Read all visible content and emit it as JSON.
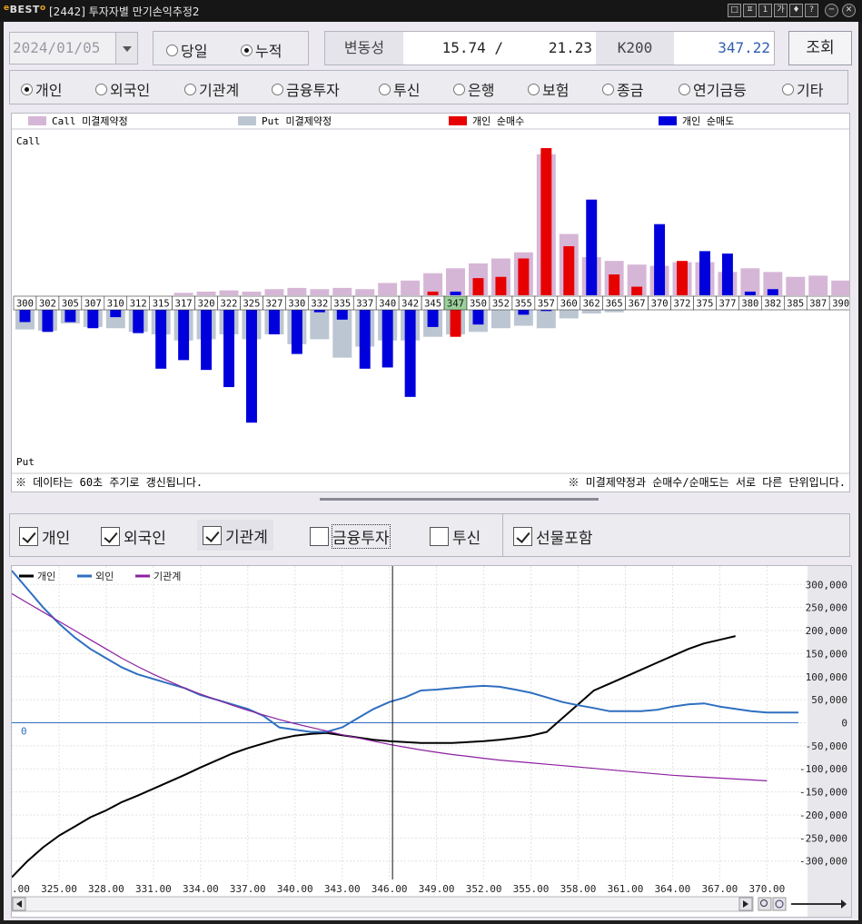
{
  "window": {
    "logo": "BEST",
    "title": "[2442] 투자자별 만기손익추정2",
    "buttons": [
      "□",
      "ㅍ",
      "1",
      "가",
      "♦",
      "?",
      "─",
      "✕"
    ]
  },
  "toolbar": {
    "date": "2024/01/05",
    "mode_options": [
      {
        "label": "당일",
        "selected": false
      },
      {
        "label": "누적",
        "selected": true
      }
    ],
    "volatility_label": "변동성",
    "volatility_call": "15.74 /",
    "volatility_put": "21.23",
    "k200_label": "K200",
    "k200_value": "347.22",
    "query_button": "조회"
  },
  "investors": [
    {
      "label": "개인",
      "selected": true
    },
    {
      "label": "외국인",
      "selected": false
    },
    {
      "label": "기관계",
      "selected": false
    },
    {
      "label": "금융투자",
      "selected": false
    },
    {
      "label": "투신",
      "selected": false
    },
    {
      "label": "은행",
      "selected": false
    },
    {
      "label": "보험",
      "selected": false
    },
    {
      "label": "종금",
      "selected": false
    },
    {
      "label": "연기금등",
      "selected": false
    },
    {
      "label": "기타",
      "selected": false
    }
  ],
  "open_interest_chart": {
    "legend": [
      "Call 미결제약정",
      "Put 미결제약정",
      "개인 순매수",
      "개인 순매도"
    ],
    "colors": {
      "call_oi": "#d6b6d6",
      "put_oi": "#bcc6d2",
      "net_buy": "#e60000",
      "net_sell": "#0000dd",
      "atm": "#9ad09a"
    },
    "call_label": "Call",
    "put_label": "Put",
    "strikes": [
      "300",
      "302",
      "305",
      "307",
      "310",
      "312",
      "315",
      "317",
      "320",
      "322",
      "325",
      "327",
      "330",
      "332",
      "335",
      "337",
      "340",
      "342",
      "345",
      "347",
      "350",
      "352",
      "355",
      "357",
      "360",
      "362",
      "365",
      "367",
      "370",
      "372",
      "375",
      "377",
      "380",
      "382",
      "385",
      "387",
      "390"
    ],
    "atm_strike": "347",
    "call_oi": [
      0,
      0,
      0,
      0,
      0,
      0,
      0,
      2,
      3,
      4,
      3,
      5,
      6,
      5,
      6,
      5,
      10,
      12,
      18,
      22,
      26,
      30,
      35,
      115,
      50,
      31,
      28,
      25,
      24,
      27,
      27,
      19,
      22,
      19,
      15,
      16,
      12
    ],
    "call_net": [
      0,
      0,
      0,
      0,
      0,
      0,
      0,
      0,
      0,
      0,
      0,
      0,
      0,
      0,
      0,
      0,
      0,
      0,
      3,
      -3,
      14,
      15,
      30,
      120,
      40,
      -78,
      17,
      7,
      -58,
      28,
      -36,
      -34,
      -3,
      -5,
      0,
      0,
      0
    ],
    "put_oi": [
      16,
      17,
      11,
      14,
      15,
      18,
      20,
      25,
      24,
      20,
      24,
      20,
      28,
      24,
      39,
      30,
      25,
      25,
      22,
      20,
      18,
      15,
      13,
      15,
      7,
      3,
      2,
      0,
      0,
      0,
      0,
      0,
      0,
      0,
      0,
      0,
      0
    ],
    "put_net": [
      -10,
      -18,
      -10,
      -15,
      -6,
      -19,
      -48,
      -41,
      -49,
      -63,
      -92,
      -20,
      -36,
      -2,
      -8,
      -48,
      -47,
      -71,
      -14,
      22,
      -12,
      0,
      -4,
      -1,
      0,
      0,
      0,
      0,
      0,
      0,
      0,
      0,
      0,
      0,
      0,
      0,
      0
    ],
    "footer_left": "※ 데이타는 60초 주기로 갱신됩니다.",
    "footer_right": "※ 미결제약정과 순매수/순매도는 서로 다른 단위입니다."
  },
  "series_toggles": [
    {
      "label": "개인",
      "checked": true
    },
    {
      "label": "외국인",
      "checked": true
    },
    {
      "label": "기관계",
      "checked": true
    },
    {
      "label": "금융투자",
      "checked": false
    },
    {
      "label": "투신",
      "checked": false
    },
    {
      "label": "선물포함",
      "checked": true
    }
  ],
  "chart_data": {
    "type": "line",
    "x": [
      322,
      323,
      324,
      325,
      326,
      327,
      328,
      329,
      330,
      331,
      332,
      333,
      334,
      335,
      336,
      337,
      338,
      339,
      340,
      341,
      342,
      343,
      344,
      345,
      346,
      347,
      348,
      349,
      350,
      351,
      352,
      353,
      354,
      355,
      356,
      357,
      358,
      359,
      360,
      361,
      362,
      363,
      364,
      365,
      366,
      367,
      368,
      369,
      370,
      371,
      372
    ],
    "series": [
      {
        "name": "개인",
        "color": "#000000",
        "values": [
          -335000,
          -300000,
          -270000,
          -245000,
          -225000,
          -205000,
          -190000,
          -172000,
          -158000,
          -143000,
          -128000,
          -113000,
          -97000,
          -82000,
          -67000,
          -55000,
          -45000,
          -35000,
          -28000,
          -24000,
          -22000,
          -27000,
          -32000,
          -37000,
          -40000,
          -42000,
          -44000,
          -44000,
          -44000,
          -42000,
          -40000,
          -37000,
          -33000,
          -28000,
          -20000,
          10000,
          40000,
          70000,
          85000,
          100000,
          115000,
          130000,
          145000,
          160000,
          172000,
          180000,
          188000
        ]
      },
      {
        "name": "외인",
        "color": "#2f6fc0",
        "values": [
          330000,
          290000,
          250000,
          215000,
          185000,
          160000,
          140000,
          120000,
          105000,
          95000,
          85000,
          75000,
          60000,
          50000,
          40000,
          30000,
          15000,
          -10000,
          -15000,
          -20000,
          -20000,
          -10000,
          10000,
          30000,
          45000,
          55000,
          70000,
          72000,
          75000,
          78000,
          80000,
          78000,
          72000,
          65000,
          55000,
          45000,
          38000,
          32000,
          25000,
          25000,
          25000,
          28000,
          35000,
          40000,
          42000,
          35000,
          30000,
          25000,
          22000,
          22000,
          22000
        ]
      },
      {
        "name": "기관계",
        "color": "#8c1fa0",
        "values": [
          280000,
          260000,
          240000,
          220000,
          200000,
          180000,
          160000,
          140000,
          122000,
          105000,
          90000,
          75000,
          62000,
          50000,
          38000,
          27000,
          17000,
          7000,
          -2000,
          -10000,
          -18000,
          -26000,
          -33000,
          -40000,
          -47000,
          -53000,
          -59000,
          -64000,
          -69000,
          -73000,
          -77000,
          -81000,
          -84000,
          -87000,
          -90000,
          -93000,
          -96000,
          -99000,
          -102000,
          -105000,
          -108000,
          -111000,
          -114000,
          -116000,
          -118000,
          -120000,
          -122000,
          -124000,
          -126000
        ]
      }
    ],
    "yticks": [
      "300,000",
      "250,000",
      "200,000",
      "150,000",
      "100,000",
      "50,000",
      "0",
      "-50,000",
      "-100,000",
      "-150,000",
      "-200,000",
      "-250,000",
      "-300,000"
    ],
    "xticks": [
      "322.00",
      "325.00",
      "328.00",
      "331.00",
      "334.00",
      "337.00",
      "340.00",
      "343.00",
      "346.00",
      "349.00",
      "352.00",
      "355.00",
      "358.00",
      "361.00",
      "364.00",
      "367.00",
      "370.00"
    ],
    "zero_label": "0",
    "ylim": [
      -340000,
      340000
    ],
    "xlim": [
      322,
      372
    ],
    "cursor_x": 346.2
  }
}
